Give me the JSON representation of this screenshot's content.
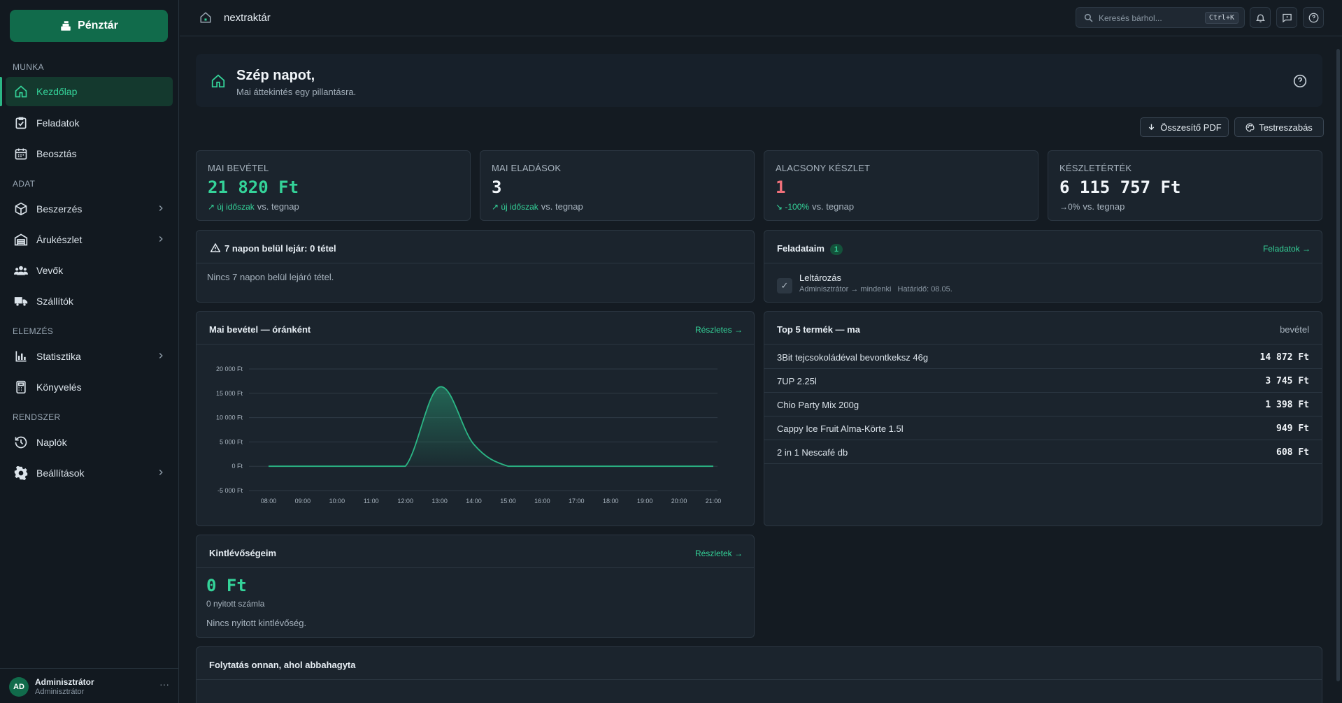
{
  "sidebar": {
    "pos_button": "Pénztár",
    "sections": {
      "munka": "MUNKA",
      "adat": "ADAT",
      "elemzes": "ELEMZÉS",
      "rendszer": "RENDSZER"
    },
    "items": [
      {
        "label": "Kezdőlap",
        "icon": "home-icon",
        "active": true
      },
      {
        "label": "Feladatok",
        "icon": "tasks-icon"
      },
      {
        "label": "Beosztás",
        "icon": "calendar-icon"
      },
      {
        "label": "Beszerzés",
        "icon": "box-icon",
        "has_children": true
      },
      {
        "label": "Árukészlet",
        "icon": "warehouse-icon",
        "has_children": true
      },
      {
        "label": "Vevők",
        "icon": "users-icon"
      },
      {
        "label": "Szállítók",
        "icon": "truck-icon"
      },
      {
        "label": "Statisztika",
        "icon": "chart-icon",
        "has_children": true
      },
      {
        "label": "Könyvelés",
        "icon": "calculator-icon"
      },
      {
        "label": "Naplók",
        "icon": "history-icon"
      },
      {
        "label": "Beállítások",
        "icon": "gear-icon",
        "has_children": true
      }
    ],
    "user": {
      "initials": "AD",
      "name": "Adminisztrátor",
      "role": "Adminisztrátor",
      "more": "···"
    }
  },
  "topbar": {
    "app_name": "nextraktár",
    "search_placeholder": "Keresés bárhol...",
    "search_shortcut": "Ctrl+K"
  },
  "hero": {
    "title": "Szép napot,",
    "subtitle": "Mai áttekintés egy pillantásra."
  },
  "actions": {
    "pdf": "Összesítő PDF",
    "customize": "Testreszabás"
  },
  "kpis": [
    {
      "label": "MAI BEVÉTEL",
      "value": "21 820 Ft",
      "trend": "↗ új időszak",
      "vs": "vs. tegnap",
      "color": "#34d399",
      "trend_color": "#34d399"
    },
    {
      "label": "MAI ELADÁSOK",
      "value": "3",
      "trend": "↗ új időszak",
      "vs": "vs. tegnap",
      "color": "#f1f5f9",
      "trend_color": "#34d399"
    },
    {
      "label": "ALACSONY KÉSZLET",
      "value": "1",
      "trend": "↘ -100%",
      "vs": "vs. tegnap",
      "color": "#f0707a",
      "trend_color": "#34d399"
    },
    {
      "label": "KÉSZLETÉRTÉK",
      "value": "6 115 757 Ft",
      "trend": "→0%",
      "vs": "vs. tegnap",
      "color": "#f1f5f9",
      "trend_color": "#a8b4bf"
    }
  ],
  "expiry": {
    "title": "7 napon belül lejár: 0 tétel",
    "empty": "Nincs 7 napon belül lejáró tétel."
  },
  "tasks": {
    "title": "Feladataim",
    "count": "1",
    "link": "Feladatok →",
    "items": [
      {
        "title": "Leltározás",
        "meta": "Adminisztrátor → mindenki",
        "due": "Határidő: 08.05."
      }
    ]
  },
  "revenue_chart": {
    "title": "Mai bevétel — óránként",
    "link": "Részletes →"
  },
  "chart_data": {
    "type": "area",
    "title": "Mai bevétel — óránként",
    "x": [
      "08:00",
      "09:00",
      "10:00",
      "11:00",
      "12:00",
      "13:00",
      "14:00",
      "15:00",
      "16:00",
      "17:00",
      "18:00",
      "19:00",
      "20:00",
      "21:00"
    ],
    "series": [
      {
        "values": [
          0,
          0,
          0,
          0,
          0,
          16300,
          4500,
          0,
          0,
          0,
          0,
          0,
          0,
          0
        ]
      }
    ],
    "y_ticks": [
      "20 000 Ft",
      "15 000 Ft",
      "10 000 Ft",
      "5 000 Ft",
      "0 Ft",
      "-5 000 Ft"
    ],
    "y_tick_values": [
      20000,
      15000,
      10000,
      5000,
      0,
      -5000
    ],
    "ylim": [
      -5000,
      20000
    ],
    "grid": true,
    "color": "#2bb685"
  },
  "top_products": {
    "title": "Top 5 termék — ma",
    "metric": "bevétel",
    "rows": [
      {
        "name": "3Bit tejcsokoládéval bevontkeksz 46g",
        "value": "14 872 Ft"
      },
      {
        "name": "7UP 2.25l",
        "value": "3 745 Ft"
      },
      {
        "name": "Chio Party Mix 200g",
        "value": "1 398 Ft"
      },
      {
        "name": "Cappy Ice Fruit Alma-Körte 1.5l",
        "value": "949 Ft"
      },
      {
        "name": "2 in 1 Nescafé db",
        "value": "608 Ft"
      }
    ]
  },
  "receivables": {
    "title": "Kintlévőségeim",
    "link": "Részletek →",
    "amount": "0 Ft",
    "open_invoices": "0 nyitott számla",
    "empty": "Nincs nyitott kintlévőség."
  },
  "continue": {
    "title": "Folytatás onnan, ahol abbahagyta"
  }
}
